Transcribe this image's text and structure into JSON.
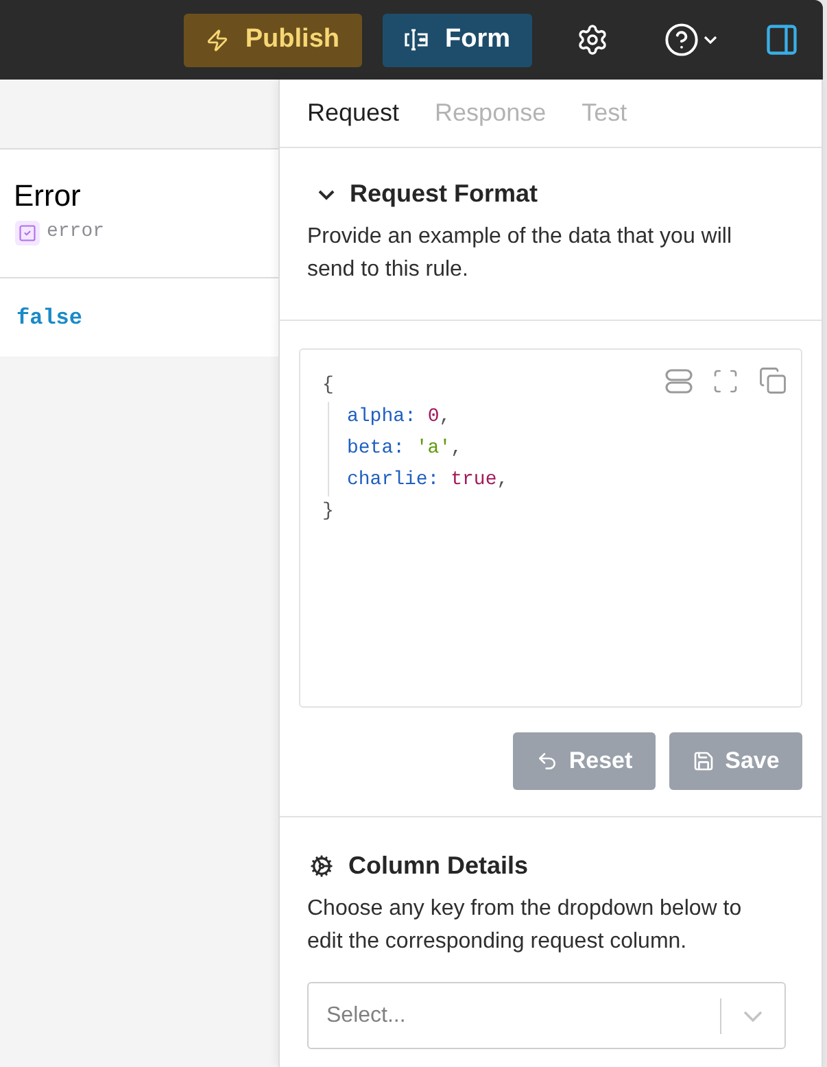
{
  "toolbar": {
    "buttons": [
      {
        "label": "Publish",
        "kind": "publish"
      },
      {
        "label": "Form",
        "kind": "form"
      }
    ]
  },
  "record": {
    "title": "Error",
    "type_label": "error",
    "value": "false"
  },
  "panel": {
    "tabs": [
      {
        "label": "Request",
        "selected": true
      },
      {
        "label": "Response",
        "selected": false
      },
      {
        "label": "Test",
        "selected": false
      }
    ],
    "request_format": {
      "title": "Request Format",
      "expanded": true,
      "description": "Provide an example of the data that you will send to this rule.",
      "code": {
        "open": "{",
        "entries": [
          {
            "tokens": [
              {
                "text": "alpha:",
                "kind": "key"
              },
              {
                "text": "0",
                "kind": "number"
              },
              {
                "text": ",",
                "kind": "punct"
              }
            ]
          },
          {
            "tokens": [
              {
                "text": "beta:",
                "kind": "key"
              },
              {
                "text": "'a'",
                "kind": "string"
              },
              {
                "text": ",",
                "kind": "punct"
              }
            ]
          },
          {
            "tokens": [
              {
                "text": "charlie:",
                "kind": "key"
              },
              {
                "text": "true",
                "kind": "boolean"
              },
              {
                "text": ",",
                "kind": "punct"
              }
            ]
          }
        ],
        "close": "}"
      },
      "buttons": [
        {
          "label": "Reset",
          "kind": "reset",
          "disabled": true
        },
        {
          "label": "Save",
          "kind": "save",
          "disabled": true
        }
      ]
    },
    "column_details": {
      "title": "Column Details",
      "description": "Choose any key from the dropdown below to edit the corresponding request column.",
      "select": {
        "placeholder": "Select..."
      }
    }
  }
}
